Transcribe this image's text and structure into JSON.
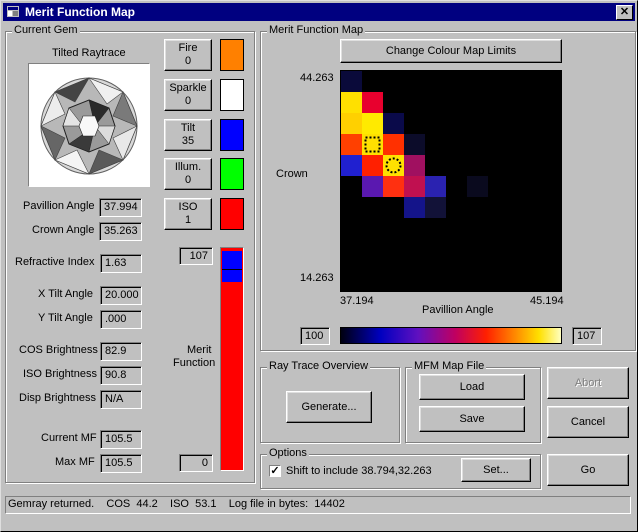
{
  "window": {
    "title": "Merit Function Map"
  },
  "current_gem": {
    "title": "Current Gem",
    "raytrace_label": "Tilted Raytrace",
    "fire": {
      "label": "Fire",
      "value": "0",
      "color": "#ff8000"
    },
    "sparkle": {
      "label": "Sparkle",
      "value": "0",
      "color": "#ffffff"
    },
    "tilt": {
      "label": "Tilt",
      "value": "35",
      "color": "#0000ff"
    },
    "illum": {
      "label": "Illum.",
      "value": "0",
      "color": "#00ff00"
    },
    "iso": {
      "label": "ISO",
      "value": "1",
      "color": "#ff0000"
    },
    "pavillion_angle": {
      "label": "Pavillion Angle",
      "value": "37.994"
    },
    "crown_angle": {
      "label": "Crown Angle",
      "value": "35.263"
    },
    "refractive_index": {
      "label": "Refractive Index",
      "value": "1.63"
    },
    "x_tilt_angle": {
      "label": "X Tilt Angle",
      "value": "20.000"
    },
    "y_tilt_angle": {
      "label": "Y Tilt Angle",
      "value": ".000"
    },
    "cos_brightness": {
      "label": "COS Brightness",
      "value": "82.9"
    },
    "iso_brightness": {
      "label": "ISO Brightness",
      "value": "90.8"
    },
    "disp_brightness": {
      "label": "Disp Brightness",
      "value": "N/A"
    },
    "current_mf": {
      "label": "Current MF",
      "value": "105.5"
    },
    "max_mf": {
      "label": "Max MF",
      "value": "105.5"
    },
    "merit_bar": {
      "label_line1": "Merit",
      "label_line2": "Function",
      "max": "107",
      "min": "0",
      "current_fraction": 0.986,
      "max_fraction": 0.986
    }
  },
  "mfm": {
    "title": "Merit Function Map",
    "change_limits_button": "Change Colour Map Limits",
    "crown_label": "Crown",
    "pavillion_label": "Pavillion Angle",
    "y_max": "44.263",
    "y_min": "14.263",
    "x_min": "37.194",
    "x_max": "45.194",
    "scale_min": "100",
    "scale_max": "107",
    "grid": {
      "cells": [
        {
          "col": 0,
          "row": 0,
          "color": "#0a0a3a"
        },
        {
          "col": 0,
          "row": 1,
          "color": "#ffe000"
        },
        {
          "col": 1,
          "row": 1,
          "color": "#e8002e"
        },
        {
          "col": 0,
          "row": 2,
          "color": "#ffd000"
        },
        {
          "col": 1,
          "row": 2,
          "color": "#ffea00"
        },
        {
          "col": 2,
          "row": 2,
          "color": "#0a0a4a"
        },
        {
          "col": 0,
          "row": 3,
          "color": "#ff4000"
        },
        {
          "col": 1,
          "row": 3,
          "color": "#ffe000"
        },
        {
          "col": 2,
          "row": 3,
          "color": "#ff3000"
        },
        {
          "col": 3,
          "row": 3,
          "color": "#0c0c2a"
        },
        {
          "col": 0,
          "row": 4,
          "color": "#2020d0"
        },
        {
          "col": 1,
          "row": 4,
          "color": "#ff2000"
        },
        {
          "col": 2,
          "row": 4,
          "color": "#ffe000"
        },
        {
          "col": 3,
          "row": 4,
          "color": "#a01060"
        },
        {
          "col": 1,
          "row": 5,
          "color": "#5a18b0"
        },
        {
          "col": 2,
          "row": 5,
          "color": "#ff3010"
        },
        {
          "col": 3,
          "row": 5,
          "color": "#c01050"
        },
        {
          "col": 4,
          "row": 5,
          "color": "#2a22b0"
        },
        {
          "col": 6,
          "row": 5,
          "color": "#0a0a1e"
        },
        {
          "col": 3,
          "row": 6,
          "color": "#14148a"
        },
        {
          "col": 4,
          "row": 6,
          "color": "#121238"
        }
      ],
      "markers": [
        {
          "col": 1,
          "row": 3,
          "shape": "square"
        },
        {
          "col": 2,
          "row": 4,
          "shape": "circle"
        }
      ]
    }
  },
  "ray_trace": {
    "title": "Ray Trace Overview",
    "generate_button": "Generate..."
  },
  "mfm_file": {
    "title": "MFM Map File",
    "load_button": "Load",
    "save_button": "Save"
  },
  "actions": {
    "abort_button": "Abort",
    "cancel_button": "Cancel",
    "go_button": "Go"
  },
  "options": {
    "title": "Options",
    "shift_label": "Shift to include 38.794,32.263",
    "shift_checked": true,
    "set_button": "Set..."
  },
  "status_bar": {
    "text": "Gemray returned.    COS  44.2    ISO  53.1    Log file in bytes:  14402"
  }
}
